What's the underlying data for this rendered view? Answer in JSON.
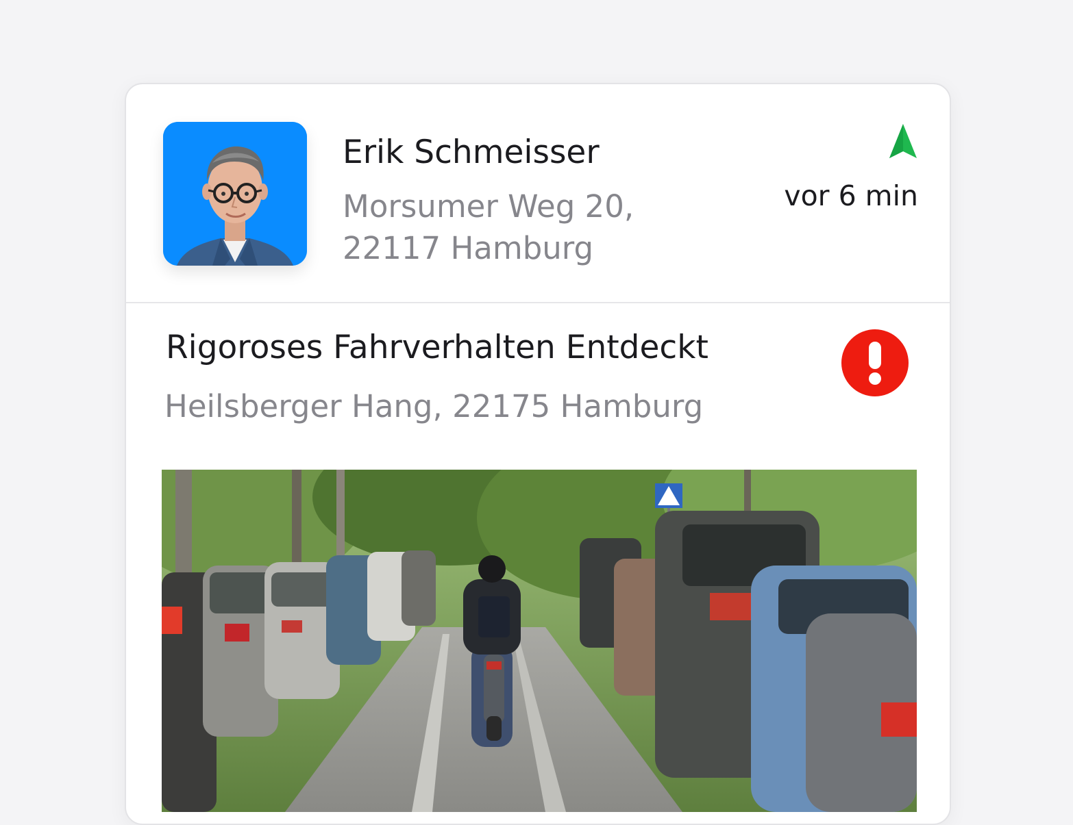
{
  "contact": {
    "name": "Erik Schmeisser",
    "address_line1": "Morsumer Weg 20,",
    "address_line2": "22117 Hamburg",
    "time_ago": "vor 6 min",
    "avatar_icon": "person-photo",
    "nav_icon": "navigation-arrow-icon"
  },
  "alert": {
    "title": "Rigoroses Fahrverhalten Entdeckt",
    "location": "Heilsberger Hang, 22175 Hamburg",
    "icon": "exclamation-icon",
    "photo": "street-with-parked-cars-and-scooter-rider"
  },
  "colors": {
    "accent_blue": "#0a8cff",
    "nav_green": "#1fb84f",
    "alert_red": "#ee1c10",
    "text_primary": "#1b1b1f",
    "text_secondary": "#86868c"
  }
}
